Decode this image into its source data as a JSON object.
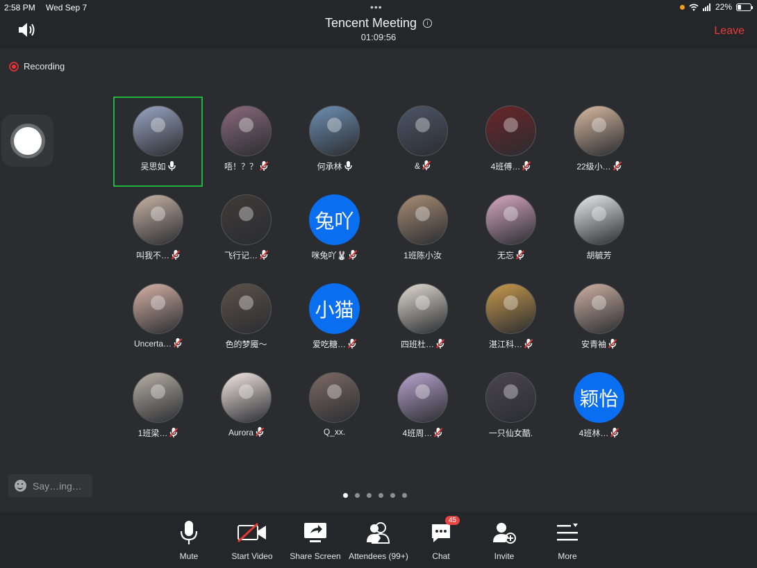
{
  "status": {
    "time": "2:58 PM",
    "date": "Wed Sep 7",
    "battery": "22%"
  },
  "header": {
    "title": "Tencent Meeting",
    "elapsed": "01:09:56",
    "leave_label": "Leave"
  },
  "recording_label": "Recording",
  "chat_placeholder": "Say…ing…",
  "participants": [
    {
      "name": "吴思如",
      "mic": "on",
      "active": true,
      "photo": "#9aa6c4"
    },
    {
      "name": "唔！？？",
      "mic": "muted",
      "photo": "#8b6a7c"
    },
    {
      "name": "何承林",
      "mic": "on",
      "photo": "#6d8fb2"
    },
    {
      "name": "&",
      "mic": "muted",
      "photo": "#4d5568"
    },
    {
      "name": "4班傅…",
      "mic": "muted",
      "photo": "#6b2428"
    },
    {
      "name": "22级小…",
      "mic": "muted",
      "photo": "#d9b9a0"
    },
    {
      "name": "叫我不…",
      "mic": "muted",
      "photo": "#c9b3a5"
    },
    {
      "name": "飞行记…",
      "mic": "muted",
      "photo": "#3f3a38"
    },
    {
      "name": "咪兔吖🐰",
      "mic": "muted",
      "avatar_text": "兔吖"
    },
    {
      "name": "1班陈小汝",
      "mic": "none",
      "photo": "#a98d74"
    },
    {
      "name": "无忘",
      "mic": "muted",
      "photo": "#d8a9c2"
    },
    {
      "name": "胡毓芳",
      "mic": "none",
      "photo": "#e9ecef"
    },
    {
      "name": "Uncerta…",
      "mic": "muted",
      "photo": "#d7b2a6"
    },
    {
      "name": "色的梦魇～",
      "mic": "none",
      "photo": "#5c5148"
    },
    {
      "name": "爱吃糖…",
      "mic": "muted",
      "avatar_text": "小猫"
    },
    {
      "name": "四班杜…",
      "mic": "muted",
      "photo": "#e3ddd2"
    },
    {
      "name": "湛江科…",
      "mic": "muted",
      "photo": "#c99a4c"
    },
    {
      "name": "安青袖",
      "mic": "muted",
      "photo": "#cfb0a2"
    },
    {
      "name": "1班梁…",
      "mic": "muted",
      "photo": "#b8b1a6"
    },
    {
      "name": "Aurora",
      "mic": "muted",
      "photo": "#f5e9e4"
    },
    {
      "name": "Q_xx.",
      "mic": "none",
      "photo": "#7d6a64"
    },
    {
      "name": "4班周…",
      "mic": "muted",
      "photo": "#b9a4cf"
    },
    {
      "name": "一只仙女酷.",
      "mic": "none",
      "photo": "#4a4550"
    },
    {
      "name": "4班林…",
      "mic": "muted",
      "avatar_text": "颖怡"
    }
  ],
  "pager": {
    "pages": 6,
    "current": 1
  },
  "toolbar": {
    "mute": "Mute",
    "start_video": "Start Video",
    "share_screen": "Share Screen",
    "attendees": "Attendees (99+)",
    "chat": "Chat",
    "chat_badge": "45",
    "invite": "Invite",
    "more": "More"
  },
  "colors": {
    "accent_red": "#ea3b3b",
    "active_border": "#1fb53e",
    "text_avatar_blue": "#0a6ef0"
  }
}
